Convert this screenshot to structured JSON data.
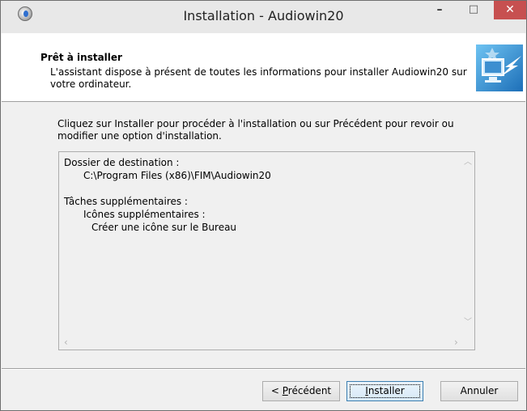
{
  "window": {
    "title": "Installation - Audiowin20"
  },
  "titlebar_buttons": {
    "minimize": "–",
    "maximize": "□",
    "close": "✕"
  },
  "header": {
    "title": "Prêt à installer",
    "description": "L'assistant dispose à présent de toutes les informations pour installer Audiowin20 sur votre ordinateur."
  },
  "instructions": "Cliquez sur Installer pour procéder à l'installation ou sur Précédent pour revoir ou modifier une option d'installation.",
  "summary": {
    "lines": [
      "Dossier de destination :",
      "C:\\Program Files (x86)\\FIM\\Audiowin20",
      "Tâches supplémentaires :",
      "Icônes supplémentaires :",
      "Créer une icône sur le Bureau"
    ]
  },
  "buttons": {
    "back_prefix": "< ",
    "back_mnemonic": "P",
    "back_rest": "récédent",
    "install_mnemonic": "I",
    "install_rest": "nstaller",
    "cancel": "Annuler"
  },
  "icons": {
    "app": "audiowin-app-icon",
    "wizard": "computer-arrow-icon"
  }
}
